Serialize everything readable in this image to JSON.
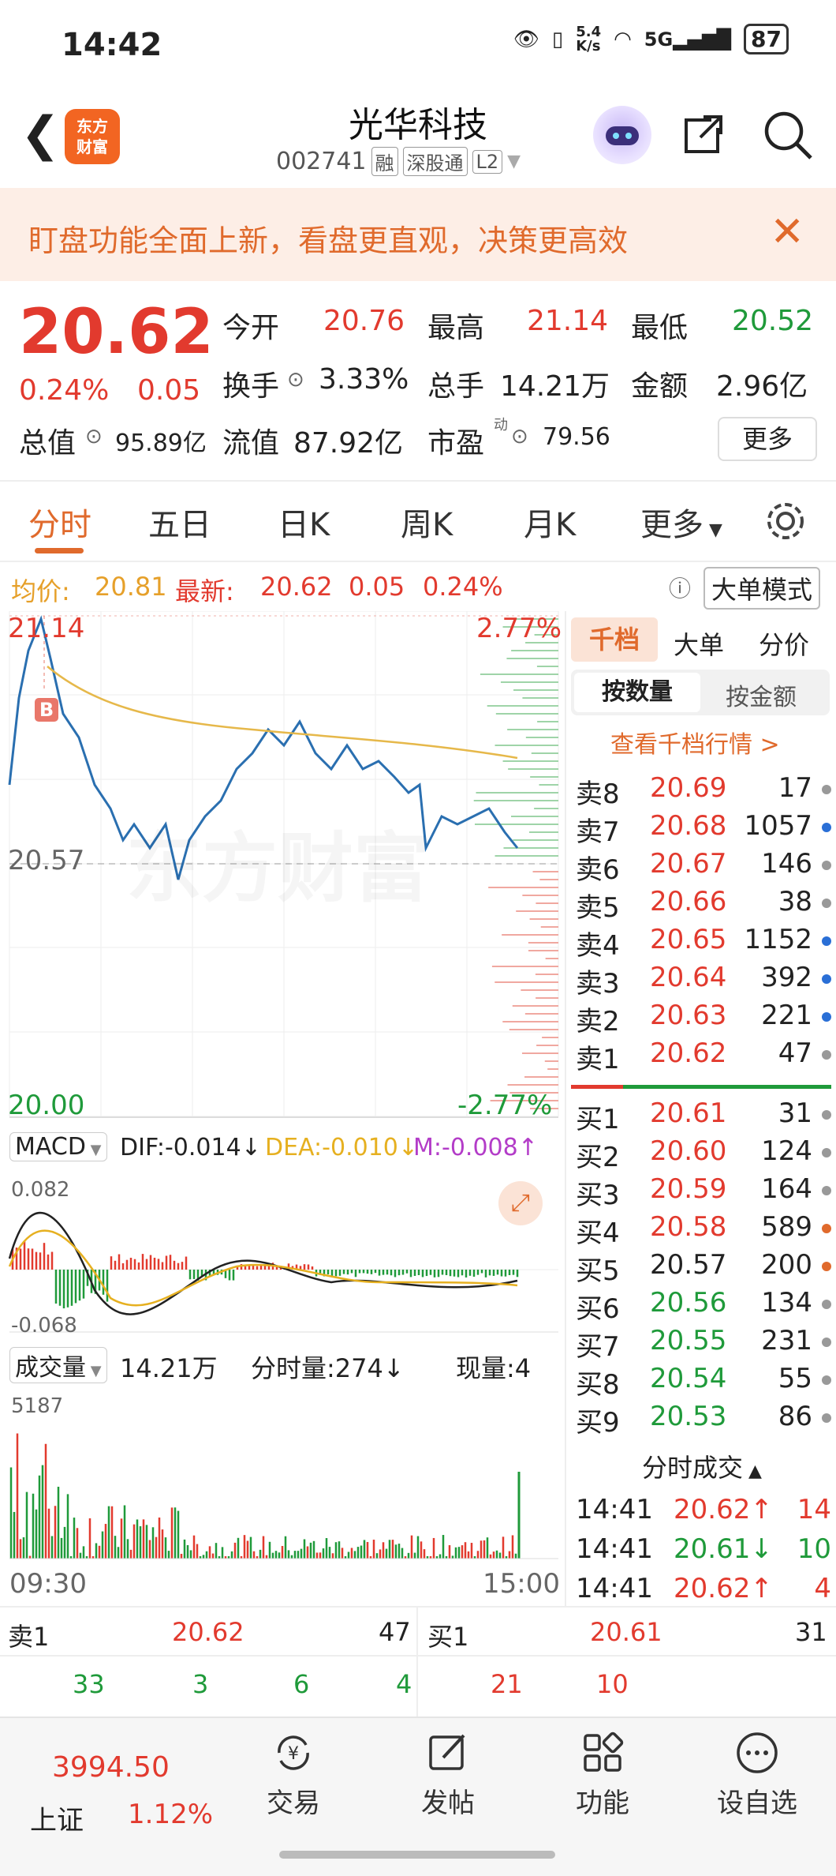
{
  "status": {
    "time": "14:42",
    "net": "5.4\nK/s",
    "battery": "87"
  },
  "nav": {
    "title": "光华科技",
    "code": "002741",
    "tags": [
      "融",
      "深股通",
      "L2"
    ]
  },
  "banner": {
    "text": "盯盘功能全面上新，看盘更直观，决策更高效"
  },
  "quote": {
    "price": "20.62",
    "change_pct": "0.24%",
    "change": "0.05",
    "open_label": "今开",
    "open": "20.76",
    "high_label": "最高",
    "high": "21.14",
    "low_label": "最低",
    "low": "20.52",
    "turnover_label": "换手",
    "turnover": "3.33%",
    "volume_label": "总手",
    "volume": "14.21万",
    "amount_label": "金额",
    "amount": "2.96亿",
    "mcap_label": "总值",
    "mcap": "95.89亿",
    "float_label": "流值",
    "float": "87.92亿",
    "pe_label": "市盈",
    "pe_sup": "动",
    "pe": "79.56",
    "more": "更多"
  },
  "tabs": [
    "分时",
    "五日",
    "日K",
    "周K",
    "月K",
    "更多"
  ],
  "avgbar": {
    "avg_label": "均价:",
    "avg": "20.81",
    "latest_label": "最新:",
    "latest": "20.62",
    "chg": "0.05",
    "pct": "0.24%",
    "mode": "大单模式"
  },
  "chart": {
    "top_price": "21.14",
    "top_pct": "2.77%",
    "mid_price": "20.57",
    "low_price": "20.00",
    "low_pct": "-2.77%",
    "marker": "B",
    "macd_label": "MACD",
    "dif": "DIF:-0.014↓",
    "dea": "DEA:-0.010↓",
    "m": "M:-0.008↑",
    "macd_top": "0.082",
    "macd_bottom": "-0.068",
    "vol_label": "成交量",
    "vol_total": "14.21万",
    "vol_min": "分时量:274↓",
    "vol_now": "现量:4",
    "vol_max": "5187",
    "t_start": "09:30",
    "t_end": "15:00",
    "watermark": "东方财富"
  },
  "book": {
    "tabs": [
      "千档",
      "大单",
      "分价"
    ],
    "mode_tabs": [
      "按数量",
      "按金额"
    ],
    "link": "查看千档行情 >",
    "sells": [
      {
        "n": "卖8",
        "p": "20.69",
        "v": "17",
        "dot": "#999"
      },
      {
        "n": "卖7",
        "p": "20.68",
        "v": "1057",
        "dot": "#2a6fd6"
      },
      {
        "n": "卖6",
        "p": "20.67",
        "v": "146",
        "dot": "#999"
      },
      {
        "n": "卖5",
        "p": "20.66",
        "v": "38",
        "dot": "#999"
      },
      {
        "n": "卖4",
        "p": "20.65",
        "v": "1152",
        "dot": "#2a6fd6"
      },
      {
        "n": "卖3",
        "p": "20.64",
        "v": "392",
        "dot": "#2a6fd6"
      },
      {
        "n": "卖2",
        "p": "20.63",
        "v": "221",
        "dot": "#2a6fd6"
      },
      {
        "n": "卖1",
        "p": "20.62",
        "v": "47",
        "dot": "#999"
      }
    ],
    "buys": [
      {
        "n": "买1",
        "p": "20.61",
        "v": "31",
        "dot": "#999"
      },
      {
        "n": "买2",
        "p": "20.60",
        "v": "124",
        "dot": "#999"
      },
      {
        "n": "买3",
        "p": "20.59",
        "v": "164",
        "dot": "#999"
      },
      {
        "n": "买4",
        "p": "20.58",
        "v": "589",
        "dot": "#e06a2c"
      },
      {
        "n": "买5",
        "p": "20.57",
        "v": "200",
        "dot": "#e06a2c"
      },
      {
        "n": "买6",
        "p": "20.56",
        "v": "134",
        "dot": "#999"
      },
      {
        "n": "买7",
        "p": "20.55",
        "v": "231",
        "dot": "#999"
      },
      {
        "n": "买8",
        "p": "20.54",
        "v": "55",
        "dot": "#999"
      },
      {
        "n": "买9",
        "p": "20.53",
        "v": "86",
        "dot": "#999"
      }
    ],
    "trades_title": "分时成交",
    "trades": [
      {
        "t": "14:41",
        "p": "20.62↑",
        "v": "14"
      },
      {
        "t": "14:41",
        "p": "20.61↓",
        "v": "10"
      },
      {
        "t": "14:41",
        "p": "20.62↑",
        "v": "4"
      }
    ]
  },
  "bottom": {
    "sell_label": "卖1",
    "sell_price": "20.62",
    "sell_vol": "47",
    "buy_label": "买1",
    "buy_price": "20.61",
    "buy_vol": "31",
    "sell_q": [
      "33",
      "3",
      "6",
      "4"
    ],
    "buy_q": [
      "21",
      "10"
    ]
  },
  "tabbar": {
    "index_value": "3994.50",
    "index_name": "上证",
    "index_pct": "1.12%",
    "items": [
      "交易",
      "发帖",
      "功能",
      "设自选"
    ]
  },
  "colors": {
    "up": "#e23a2e",
    "down": "#1f9a3a",
    "accent": "#e06a2c",
    "line": "#2a6fb0",
    "avg": "#e6b84a"
  }
}
